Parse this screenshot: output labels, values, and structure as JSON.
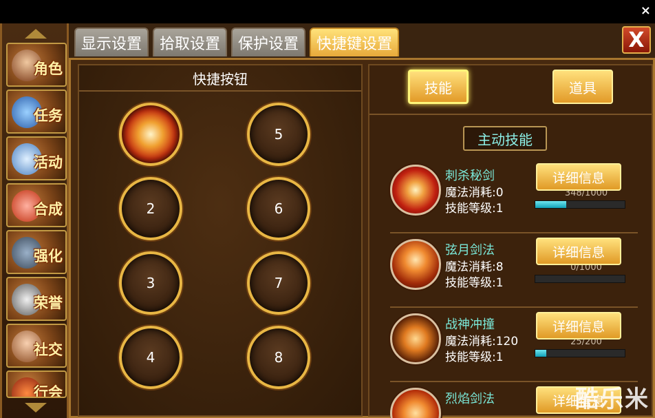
{
  "tabs": [
    {
      "label": "显示设置",
      "active": false
    },
    {
      "label": "拾取设置",
      "active": false
    },
    {
      "label": "保护设置",
      "active": false
    },
    {
      "label": "快捷键设置",
      "active": true
    }
  ],
  "sidebar": {
    "items": [
      {
        "label": "角色",
        "icon": "character-icon"
      },
      {
        "label": "任务",
        "icon": "scroll-icon"
      },
      {
        "label": "活动",
        "icon": "banner-icon"
      },
      {
        "label": "合成",
        "icon": "crystal-icon"
      },
      {
        "label": "强化",
        "icon": "anvil-icon"
      },
      {
        "label": "荣誉",
        "icon": "medal-icon"
      },
      {
        "label": "社交",
        "icon": "social-icon"
      },
      {
        "label": "行会",
        "icon": "guild-icon"
      }
    ]
  },
  "left_panel": {
    "title": "快捷按钮",
    "slots": [
      {
        "label": "",
        "has_skill": true
      },
      {
        "label": "5"
      },
      {
        "label": "2"
      },
      {
        "label": "6"
      },
      {
        "label": "3"
      },
      {
        "label": "7"
      },
      {
        "label": "4"
      },
      {
        "label": "8"
      }
    ]
  },
  "right_panel": {
    "skill_tab": "技能",
    "item_tab": "道具",
    "section_title": "主动技能",
    "skills": [
      {
        "name": "刺杀秘剑",
        "cost": "魔法消耗:0",
        "level": "技能等级:1",
        "detail": "详细信息",
        "exp": "348/1000",
        "exp_ratio": 0.348
      },
      {
        "name": "弦月剑法",
        "cost": "魔法消耗:8",
        "level": "技能等级:1",
        "detail": "详细信息",
        "exp": "0/1000",
        "exp_ratio": 0.0
      },
      {
        "name": "战神冲撞",
        "cost": "魔法消耗:120",
        "level": "技能等级:1",
        "detail": "详细信息",
        "exp": "25/200",
        "exp_ratio": 0.125
      },
      {
        "name": "烈焰剑法",
        "cost": "",
        "level": "",
        "detail": "详细信息",
        "exp": "",
        "exp_ratio": 0.0
      }
    ]
  },
  "watermark": "酷乐米",
  "close_top": "×",
  "close_btn": "X"
}
